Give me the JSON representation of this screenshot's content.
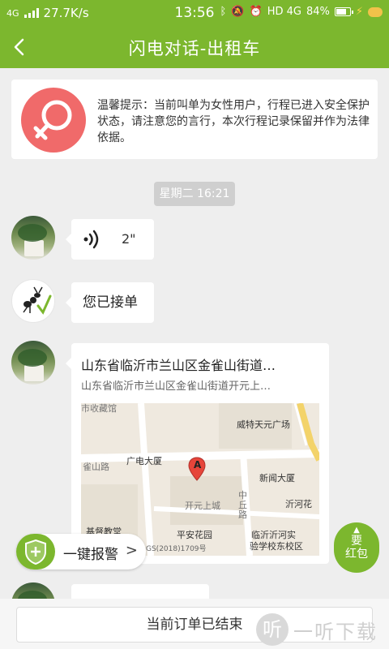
{
  "status_bar": {
    "network": "4G",
    "speed": "27.7K/s",
    "time": "13:56",
    "network_type": "HD 4G",
    "battery": "84%",
    "battery_level": 0.84,
    "icons": [
      "bluetooth-icon",
      "mute-icon",
      "alarm-icon",
      "battery-icon",
      "charging-icon"
    ]
  },
  "header": {
    "title": "闪电对话-出租车",
    "back_icon": "chevron-left-icon",
    "color": "#7cb72e"
  },
  "notice": {
    "icon": "female-icon",
    "text": "温馨提示：当前叫单为女性用户，行程已进入安全保护状态，请注意您的言行，本次行程记录保留并作为法律依据。"
  },
  "chat": {
    "timestamp": "星期二 16:21",
    "messages": [
      {
        "type": "voice",
        "duration": "2\"",
        "icon": "voice-wave-icon"
      },
      {
        "type": "text",
        "text": "您已接单"
      },
      {
        "type": "location",
        "title": "山东省临沂市兰山区金雀山街道…",
        "subtitle": "山东省临沂市兰山区金雀山街道开元上…",
        "map_labels": {
          "top_partial": "市收藏馆",
          "weite": "威特天元广场",
          "guangdian": "广电大厦",
          "queshan_road": "雀山路",
          "xinwen": "新闻大厦",
          "kaiyuan": "开元上城",
          "zhongqiu": "中丘路",
          "yihe": "沂河花",
          "jidu": "基督教堂",
          "pingan": "平安花园",
          "school_1": "临沂沂河实",
          "school_2": "验学校东校区",
          "copyright": "GS(2018)1709号",
          "pin": "A"
        }
      }
    ]
  },
  "floating": {
    "alarm_label": "一键报警",
    "alarm_arrow": ">",
    "shield_icon": "shield-plus-icon",
    "redpack_line1": "要",
    "redpack_line2": "红包"
  },
  "footer": {
    "order_status": "当前订单已结束"
  },
  "watermark": {
    "logo_char": "听",
    "text": "一听下载"
  }
}
